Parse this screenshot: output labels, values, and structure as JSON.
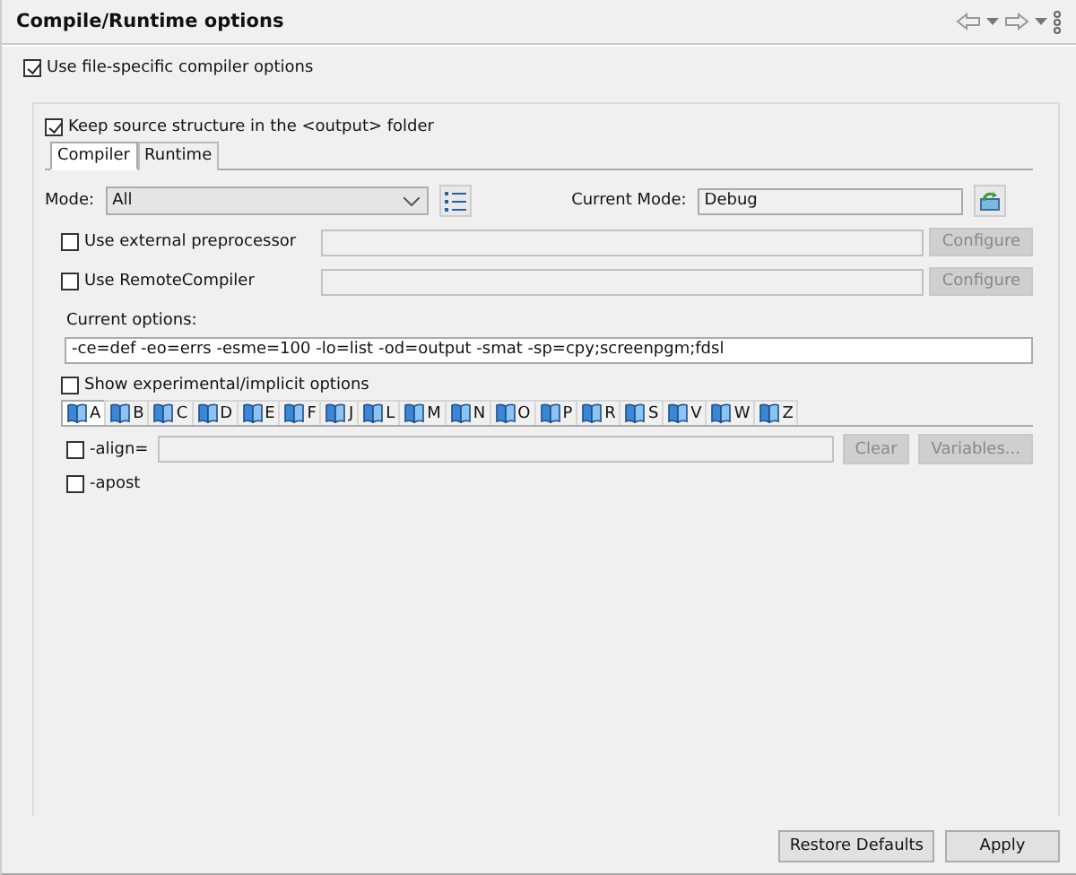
{
  "header": {
    "title": "Compile/Runtime options"
  },
  "file_specific": {
    "label": "Use file-specific compiler options",
    "checked": true
  },
  "keep_structure": {
    "label": "Keep source structure in the <output> folder",
    "checked": true
  },
  "tabs": [
    {
      "label": "Compiler",
      "selected": true
    },
    {
      "label": "Runtime",
      "selected": false
    }
  ],
  "mode": {
    "label": "Mode:",
    "value": "All"
  },
  "current_mode": {
    "label": "Current Mode:",
    "value": "Debug"
  },
  "tools": [
    {
      "label": "Use external preprocessor",
      "checked": false,
      "button": "Configure"
    },
    {
      "label": "Use RemoteCompiler",
      "checked": false,
      "button": "Configure"
    }
  ],
  "current_options": {
    "label": "Current options:",
    "value": "-ce=def -eo=errs -esme=100 -lo=list -od=output -smat -sp=cpy;screenpgm;fdsl"
  },
  "show_experimental": {
    "label": "Show experimental/implicit options",
    "checked": false
  },
  "letter_tabs": [
    {
      "label": "A",
      "selected": true
    },
    {
      "label": "B",
      "selected": false
    },
    {
      "label": "C",
      "selected": false
    },
    {
      "label": "D",
      "selected": false
    },
    {
      "label": "E",
      "selected": false
    },
    {
      "label": "F",
      "selected": false
    },
    {
      "label": "J",
      "selected": false
    },
    {
      "label": "L",
      "selected": false
    },
    {
      "label": "M",
      "selected": false
    },
    {
      "label": "N",
      "selected": false
    },
    {
      "label": "O",
      "selected": false
    },
    {
      "label": "P",
      "selected": false
    },
    {
      "label": "R",
      "selected": false
    },
    {
      "label": "S",
      "selected": false
    },
    {
      "label": "V",
      "selected": false
    },
    {
      "label": "W",
      "selected": false
    },
    {
      "label": "Z",
      "selected": false
    }
  ],
  "options": [
    {
      "kind": "field",
      "label": "-align=",
      "checked": false,
      "buttons": [
        "Clear",
        "Variables..."
      ]
    },
    {
      "kind": "flag",
      "label": "-apost",
      "checked": false
    }
  ],
  "buttons": [
    "Restore Defaults",
    "Apply"
  ]
}
